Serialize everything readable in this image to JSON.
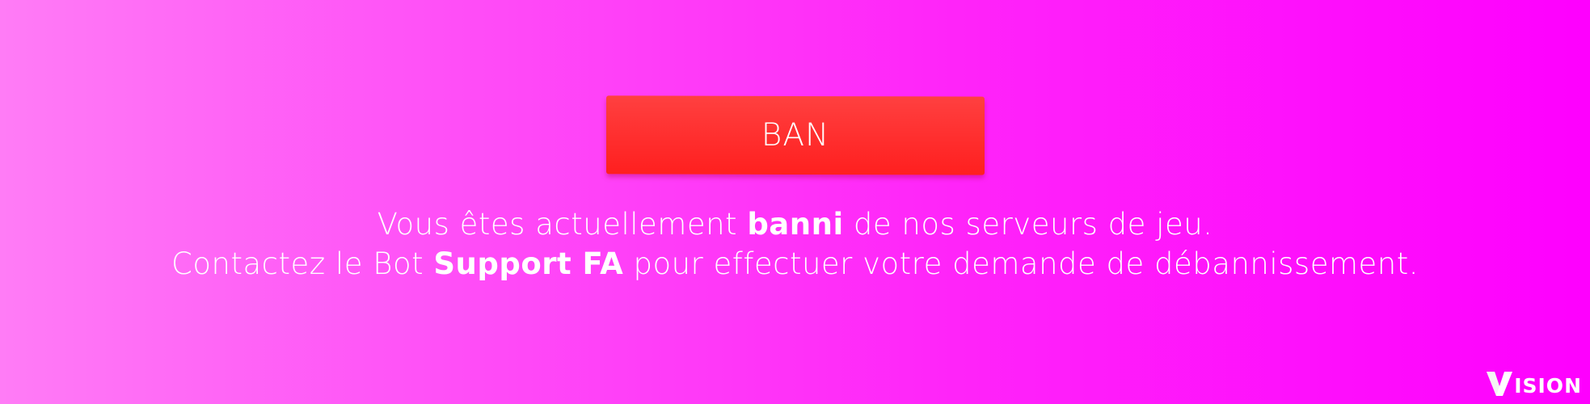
{
  "banner": {
    "button_label": "BAN",
    "line1": {
      "before": "Vous êtes actuellement ",
      "strong": "banni",
      "after": " de nos serveurs de jeu."
    },
    "line2": {
      "before": "Contactez le Bot ",
      "strong": "Support FA",
      "after": " pour effectuer votre demande de débannissement."
    }
  },
  "logo": {
    "first_letter": "V",
    "rest": "ISION"
  },
  "colors": {
    "background_start": "#ff7cf6",
    "background_end": "#fe00fe",
    "button_top": "#ff4040",
    "button_bottom": "#ff1f1f",
    "text": "#ffffff"
  }
}
